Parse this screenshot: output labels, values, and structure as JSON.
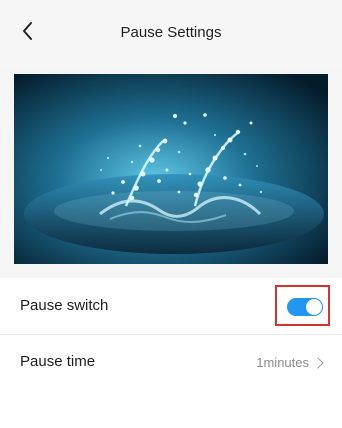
{
  "header": {
    "title": "Pause Settings",
    "back_icon": "chevron-left-icon"
  },
  "preview": {
    "alt": "Water splash image"
  },
  "settings": {
    "pause_switch_label": "Pause switch",
    "pause_switch_enabled": true,
    "pause_time_label": "Pause time",
    "pause_time_value": "1minutes",
    "pause_time_chevron": ">"
  },
  "colors": {
    "accent": "#2196f3",
    "highlight": "#d9322e",
    "muted_text": "#8b8b8b"
  }
}
